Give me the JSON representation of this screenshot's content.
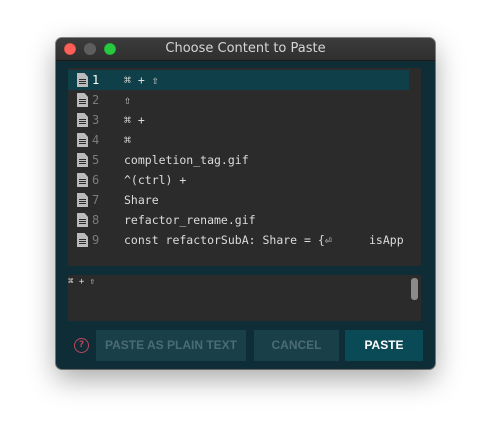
{
  "window": {
    "title": "Choose Content to Paste"
  },
  "list": {
    "items": [
      {
        "number": "1",
        "text": "⌘ + ⇧",
        "selected": true,
        "icon": "file-icon"
      },
      {
        "number": "2",
        "text": "⇧",
        "selected": false,
        "icon": "file-icon"
      },
      {
        "number": "3",
        "text": "⌘ +",
        "selected": false,
        "icon": "file-icon"
      },
      {
        "number": "4",
        "text": "⌘",
        "selected": false,
        "icon": "file-icon"
      },
      {
        "number": "5",
        "text": "completion_tag.gif",
        "selected": false,
        "icon": "file-icon"
      },
      {
        "number": "6",
        "text": "^(ctrl) +",
        "selected": false,
        "icon": "file-icon"
      },
      {
        "number": "7",
        "text": "Share",
        "selected": false,
        "icon": "file-icon"
      },
      {
        "number": "8",
        "text": "refactor_rename.gif",
        "selected": false,
        "icon": "file-icon"
      },
      {
        "number": "9",
        "text": "const refactorSubA: Share = {⏎",
        "extra": "isApp",
        "selected": false,
        "icon": "file-icon"
      }
    ]
  },
  "preview": {
    "text": "⌘ + ⇧"
  },
  "footer": {
    "help_icon": "?",
    "paste_plain_label": "PASTE AS PLAIN TEXT",
    "cancel_label": "CANCEL",
    "paste_label": "PASTE"
  },
  "colors": {
    "window_bg": "#0e2d37",
    "list_bg": "#2b2b2b",
    "selected_row": "#0f3f48",
    "primary_button": "#0a4a56",
    "help_icon": "#c0455a"
  }
}
